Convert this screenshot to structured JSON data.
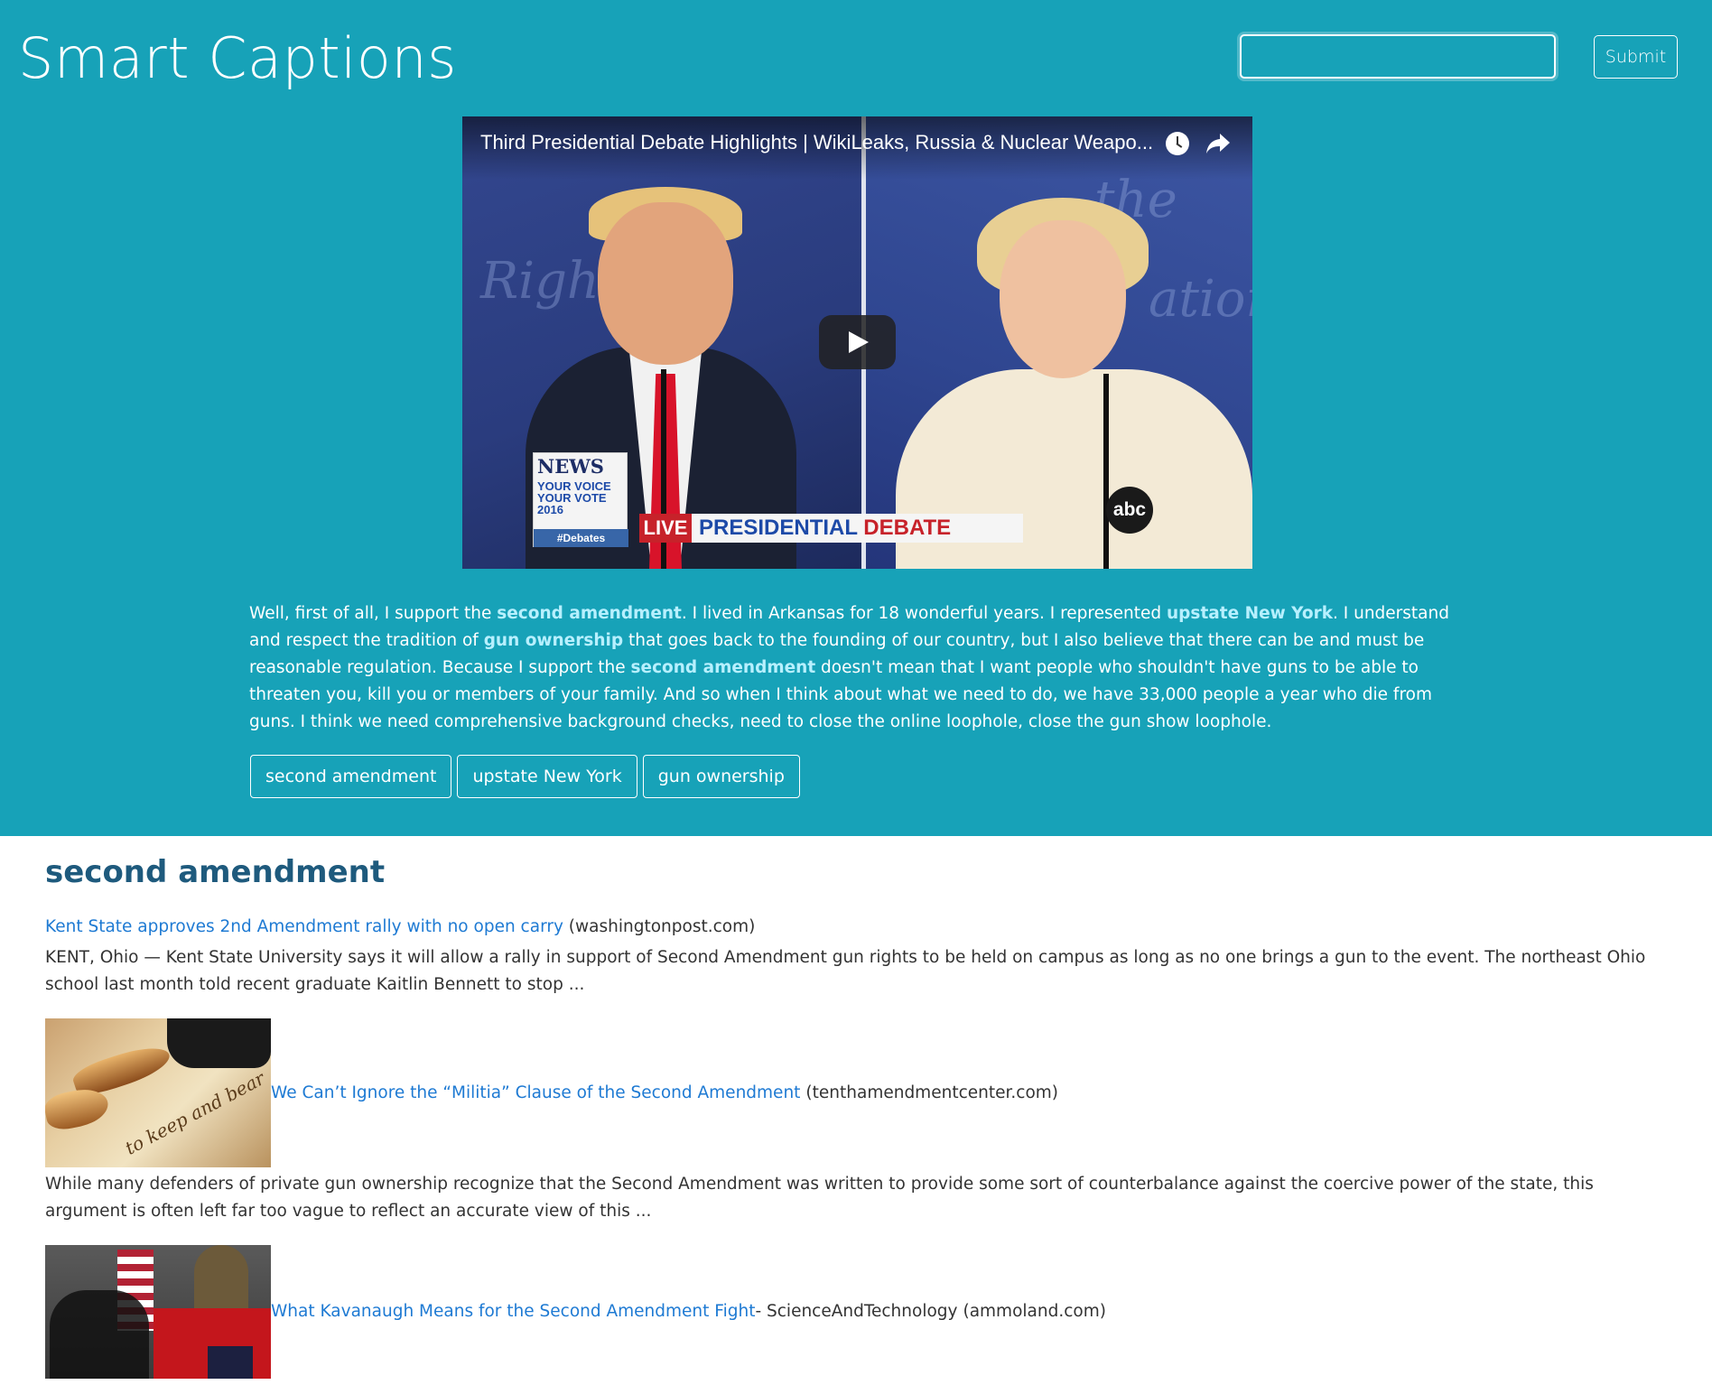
{
  "app": {
    "title": "Smart Captions"
  },
  "search": {
    "value": "",
    "submit_label": "Submit"
  },
  "video": {
    "title": "Third Presidential Debate Highlights | WikiLeaks, Russia & Nuclear Weapo...",
    "news_brand": "NEWS",
    "news_sub": "YOUR VOICE YOUR VOTE 2016",
    "news_tag": "#Debates",
    "lower_third_live": "LIVE",
    "lower_third_presidential": "PRESIDENTIAL",
    "lower_third_debate": "DEBATE",
    "network": "abc"
  },
  "caption": {
    "parts": [
      {
        "text": "Well, first of all, I support the ",
        "highlight": false
      },
      {
        "text": "second amendment",
        "highlight": true
      },
      {
        "text": ". I lived in Arkansas for 18 wonderful years. I represented ",
        "highlight": false
      },
      {
        "text": "upstate New York",
        "highlight": true
      },
      {
        "text": ". I understand and respect the tradition of ",
        "highlight": false
      },
      {
        "text": "gun ownership",
        "highlight": true
      },
      {
        "text": " that goes back to the founding of our country, but I also believe that there can be and must be reasonable regulation. Because I support the ",
        "highlight": false
      },
      {
        "text": "second amendment",
        "highlight": true
      },
      {
        "text": " doesn't mean that I want people who shouldn't have guns to be able to threaten you, kill you or members of your family. And so when I think about what we need to do, we have 33,000 people a year who die from guns. I think we need comprehensive background checks, need to close the online loophole, close the gun show loophole.",
        "highlight": false
      }
    ]
  },
  "keywords": [
    "second amendment",
    "upstate New York",
    "gun ownership"
  ],
  "results": {
    "heading": "second amendment",
    "articles": [
      {
        "title": "Kent State approves 2nd Amendment rally with no open carry",
        "author": "",
        "source": "(washingtonpost.com)",
        "description": "KENT, Ohio — Kent State University says it will allow a rally in support of Second Amendment gun rights to be held on campus as long as no one brings a gun to the event. The northeast Ohio school last month told recent graduate Kaitlin Bennett to stop ..."
      },
      {
        "title": "We Can’t Ignore the “Militia” Clause of the Second Amendment",
        "author": "",
        "source": "(tenthamendmentcenter.com)",
        "description": "While many defenders of private gun ownership recognize that the Second Amendment was written to provide some sort of counterbalance against the coercive power of the state, this argument is often left far too vague to reflect an accurate view of this ..."
      },
      {
        "title": "What Kavanaugh Means for the Second Amendment Fight",
        "author": " - ScienceAndTechnology",
        "source": "(ammoland.com)",
        "description": ""
      }
    ]
  },
  "colors": {
    "hero_bg": "#17a2b8",
    "keyword_highlight": "#b7f0ff",
    "link": "#1e7ad3",
    "heading": "#1e5a7d"
  }
}
